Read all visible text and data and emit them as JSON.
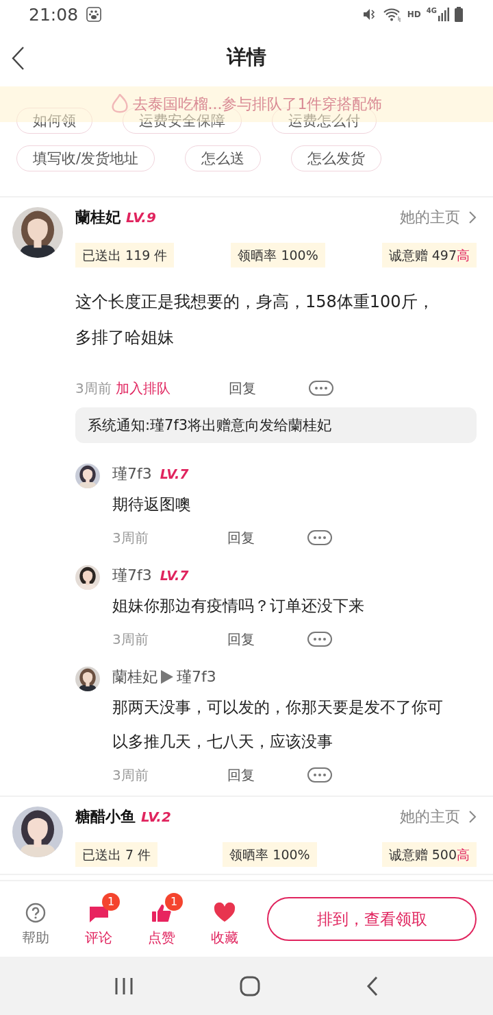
{
  "status_bar": {
    "time": "21:08",
    "hd": "HD",
    "network": "4G"
  },
  "header": {
    "title": "详情"
  },
  "questions": {
    "chip_rows": [
      [
        "如何领",
        "运费安全保障",
        "运费怎么付"
      ],
      [
        "填写收/发货地址",
        "怎么送",
        "怎么发货"
      ]
    ]
  },
  "toast": {
    "text": "去泰国吃榴...参与排队了1件穿搭配饰"
  },
  "posts": [
    {
      "name": "蘭桂妃",
      "level": "LV.9",
      "profile_link": "她的主页",
      "stats": [
        {
          "text": "已送出 119 件"
        },
        {
          "text": "领晒率 100%"
        },
        {
          "text": "诚意赠 497",
          "badge": "高"
        }
      ],
      "body": "这个长度正是我想要的，身高，158体重100斤，多排了哈姐妹",
      "time": "3周前",
      "action": "加入排队",
      "reply": "回复",
      "notice": "系统通知:瑾7f3将出赠意向发给蘭桂妃",
      "replies": [
        {
          "name": "瑾7f3",
          "level": "LV.7",
          "body": "期待返图噢",
          "time": "3周前",
          "reply": "回复"
        },
        {
          "name": "瑾7f3",
          "level": "LV.7",
          "body": "姐妹你那边有疫情吗？订单还没下来",
          "time": "3周前",
          "reply": "回复"
        },
        {
          "name": "蘭桂妃",
          "reply_to": "瑾7f3",
          "body": "那两天没事，可以发的，你那天要是发不了你可以多推几天，七八天，应该没事",
          "time": "3周前",
          "reply": "回复"
        }
      ]
    },
    {
      "name": "糖醋小鱼",
      "level": "LV.2",
      "profile_link": "她的主页",
      "stats": [
        {
          "text": "已送出 7 件"
        },
        {
          "text": "领晒率 100%"
        },
        {
          "text": "诚意赠 500",
          "badge": "高"
        }
      ]
    }
  ],
  "bottom_bar": {
    "items": [
      {
        "kind": "help",
        "label": "帮助"
      },
      {
        "kind": "comment",
        "label": "评论",
        "badge": "1"
      },
      {
        "kind": "like",
        "label": "点赞",
        "badge": "1"
      },
      {
        "kind": "favorite",
        "label": "收藏"
      }
    ],
    "primary_button": "排到，查看领取"
  }
}
